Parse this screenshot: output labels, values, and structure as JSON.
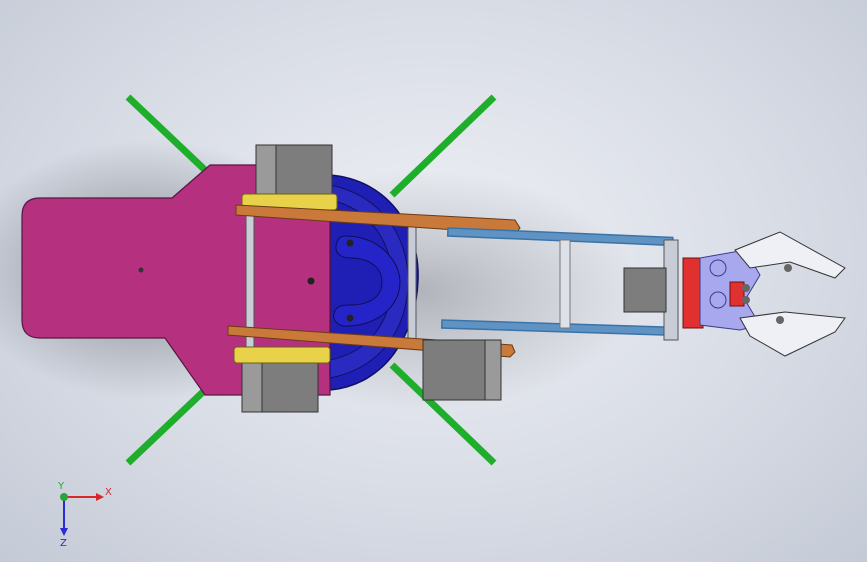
{
  "viewport": {
    "background_top": "#eef0f5",
    "background_bottom": "#c4cad6"
  },
  "model": {
    "colors": {
      "base_plate": "#b5307f",
      "turntable": "#1f1fb5",
      "legs": "#1fae2c",
      "servo_body": "#7d7d7d",
      "link_orange": "#c9793a",
      "servo_bracket_yellow": "#e8d24a",
      "arm_frame_blue": "#3b73a6",
      "gripper_lavender": "#a7a8ee",
      "gripper_red": "#e03030"
    }
  },
  "triad": {
    "x_label": "X",
    "y_label": "Y",
    "z_label": "Z",
    "x_color": "#d62828",
    "y_color": "#2aa33a",
    "z_color": "#2a2ad6"
  }
}
